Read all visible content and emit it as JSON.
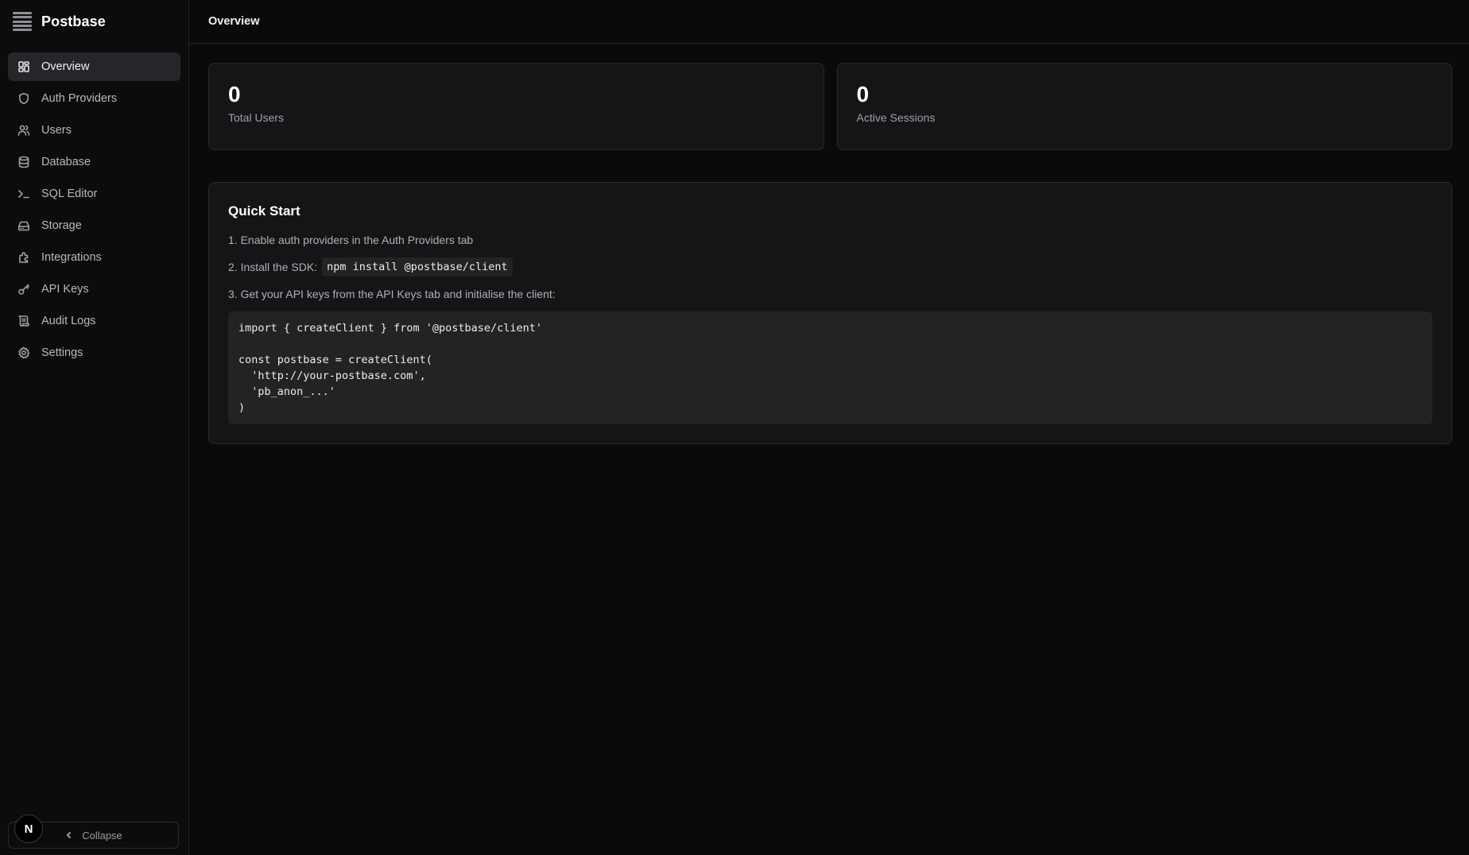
{
  "brand": {
    "name": "Postbase"
  },
  "sidebar": {
    "items": [
      {
        "label": "Overview",
        "icon": "grid-icon",
        "active": true
      },
      {
        "label": "Auth Providers",
        "icon": "shield-icon"
      },
      {
        "label": "Users",
        "icon": "users-icon"
      },
      {
        "label": "Database",
        "icon": "database-icon"
      },
      {
        "label": "SQL Editor",
        "icon": "terminal-icon"
      },
      {
        "label": "Storage",
        "icon": "storage-icon"
      },
      {
        "label": "Integrations",
        "icon": "puzzle-icon"
      },
      {
        "label": "API Keys",
        "icon": "key-icon"
      },
      {
        "label": "Audit Logs",
        "icon": "scroll-icon"
      },
      {
        "label": "Settings",
        "icon": "gear-icon"
      }
    ],
    "collapse_label": "Collapse",
    "avatar_letter": "N"
  },
  "header": {
    "title": "Overview"
  },
  "stats": [
    {
      "value": "0",
      "label": "Total Users"
    },
    {
      "value": "0",
      "label": "Active Sessions"
    }
  ],
  "quick_start": {
    "title": "Quick Start",
    "step1": "1. Enable auth providers in the Auth Providers tab",
    "step2_prefix": "2. Install the SDK:",
    "step2_code": "npm install @postbase/client",
    "step3": "3. Get your API keys from the API Keys tab and initialise the client:",
    "code": "import { createClient } from '@postbase/client'\n\nconst postbase = createClient(\n  'http://your-postbase.com',\n  'pb_anon_...'\n)"
  }
}
